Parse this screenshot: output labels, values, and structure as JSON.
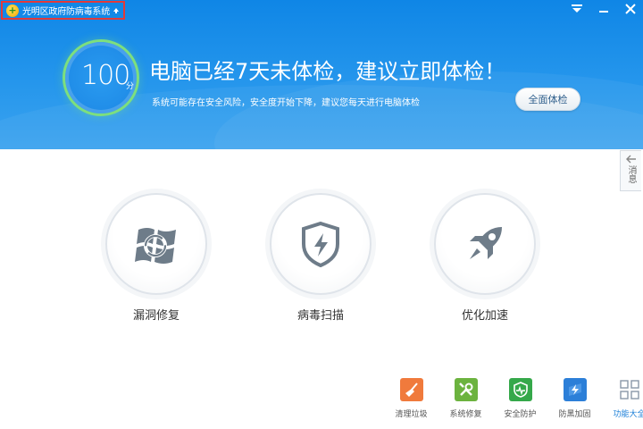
{
  "app": {
    "title": "光明区政府防病毒系统"
  },
  "window": {
    "menu_icon": "menu-icon",
    "close_icon": "close-icon"
  },
  "header": {
    "score": "100",
    "score_unit": "分",
    "headline": "电脑已经7天未体检，建议立即体检！",
    "subline": "系统可能存在安全风险，安全度开始下降，建议您每天进行电脑体检",
    "check_button": "全面体检"
  },
  "side_tab": {
    "label": "消息"
  },
  "features": [
    {
      "label": "漏洞修复",
      "icon": "windows-refresh-icon"
    },
    {
      "label": "病毒扫描",
      "icon": "shield-bolt-icon"
    },
    {
      "label": "优化加速",
      "icon": "rocket-icon"
    }
  ],
  "tools": [
    {
      "label": "清理垃圾",
      "icon": "broom-icon",
      "color": "#f07a3c"
    },
    {
      "label": "系统修复",
      "icon": "wrench-icon",
      "color": "#6cb33f"
    },
    {
      "label": "安全防护",
      "icon": "shield-pulse-icon",
      "color": "#35a84a"
    },
    {
      "label": "防黑加固",
      "icon": "lightning-shield-icon",
      "color": "#2c7fd8"
    },
    {
      "label": "功能大全",
      "icon": "grid-icon",
      "color": "#8a98a8"
    }
  ],
  "colors": {
    "header_blue": "#1b8ae6",
    "ring_green": "#7ddf7e",
    "title_box_red": "#e23a3a"
  }
}
